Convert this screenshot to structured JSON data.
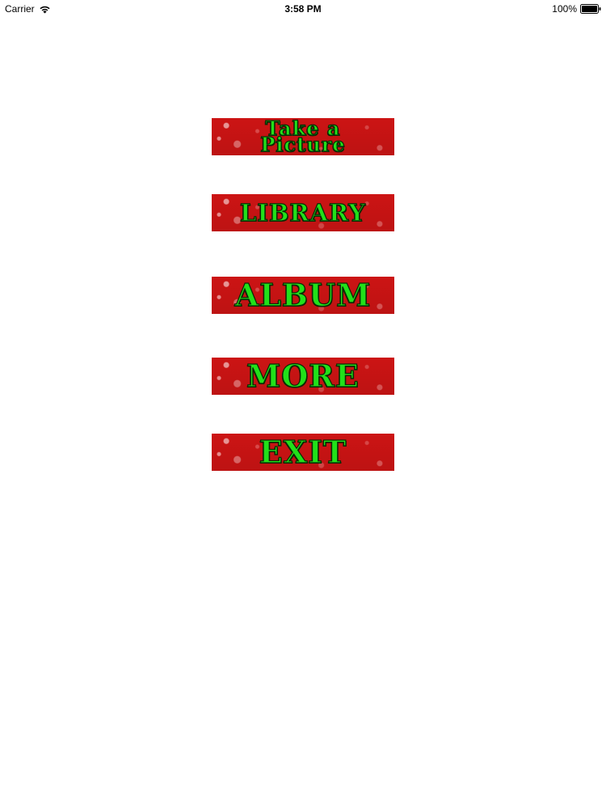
{
  "status_bar": {
    "carrier": "Carrier",
    "time": "3:58 PM",
    "battery": "100%"
  },
  "menu": {
    "items": [
      {
        "label": "Take a\nPicture"
      },
      {
        "label": "LIBRARY"
      },
      {
        "label": "ALBUM"
      },
      {
        "label": "MORE"
      },
      {
        "label": "EXIT"
      }
    ]
  },
  "colors": {
    "button_background": "#d71515",
    "label_text": "#22e01a",
    "label_outline": "#0b2a05"
  },
  "icons": [
    "wifi-icon",
    "battery-icon"
  ]
}
